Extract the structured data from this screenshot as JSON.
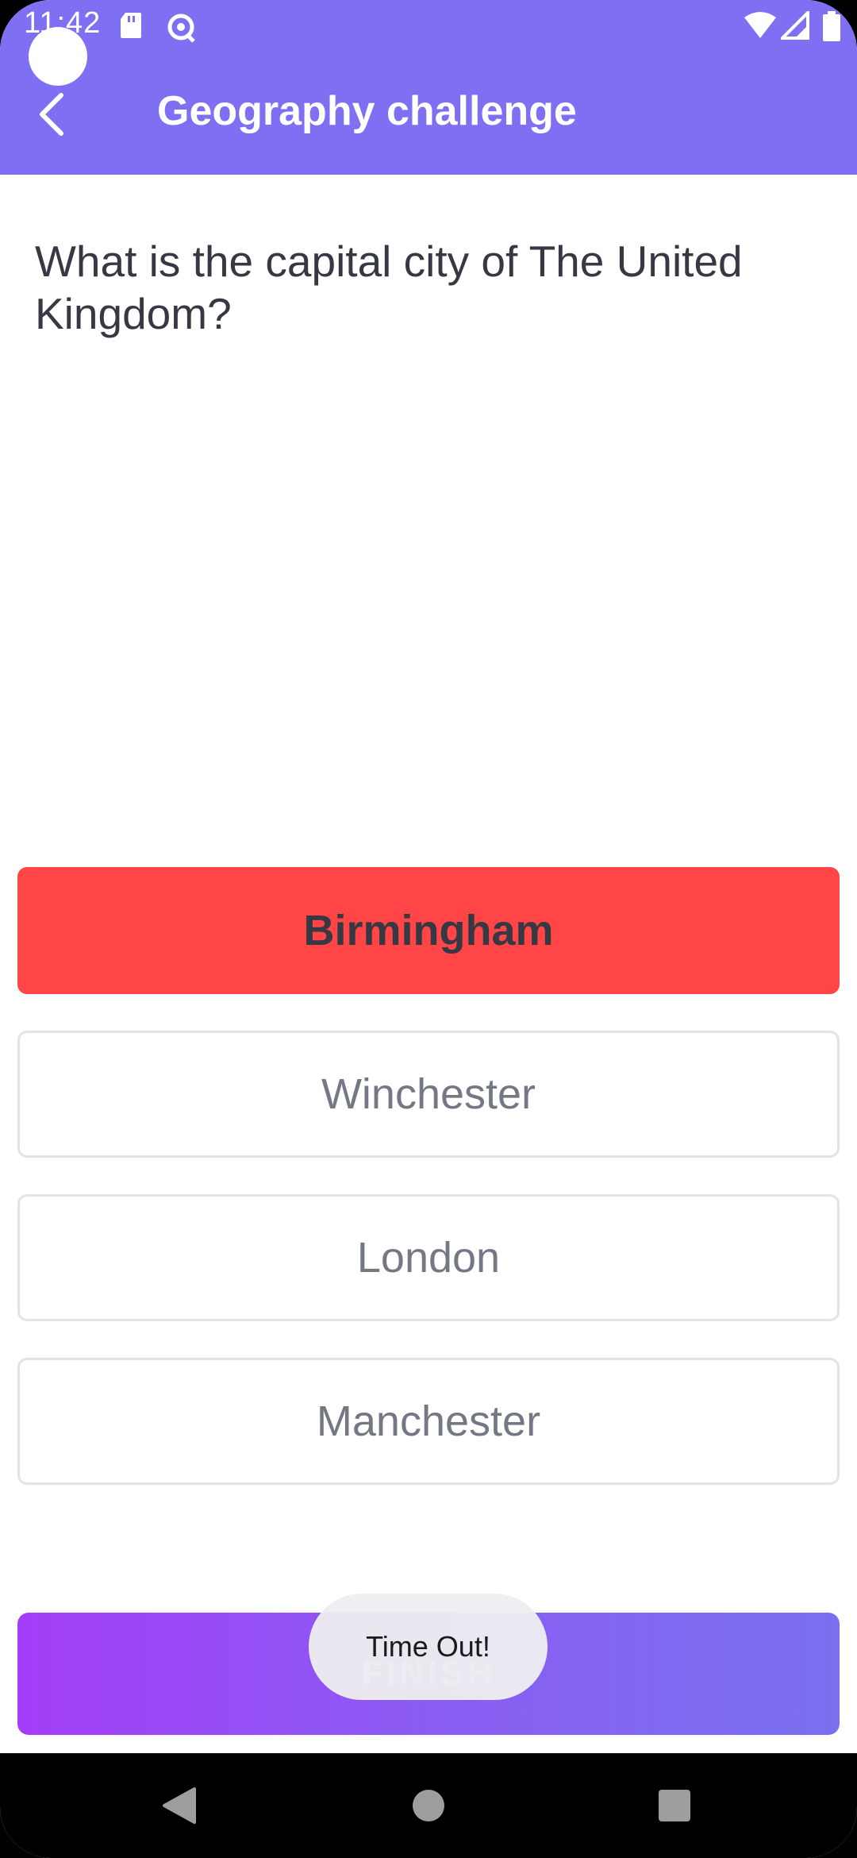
{
  "status_bar": {
    "time": "11:42",
    "icons": [
      "sd-card-icon",
      "sync-icon",
      "wifi-icon",
      "signal-icon",
      "battery-icon"
    ]
  },
  "header": {
    "title": "Geography challenge",
    "background_color": "#7f6ff2"
  },
  "quiz": {
    "question": "What is the capital city of The United Kingdom?",
    "answers": [
      {
        "label": "Birmingham",
        "state": "wrong",
        "color": "#ff4545"
      },
      {
        "label": "Winchester",
        "state": "neutral"
      },
      {
        "label": "London",
        "state": "neutral"
      },
      {
        "label": "Manchester",
        "state": "neutral"
      }
    ]
  },
  "finish_button": {
    "label": "FINISH",
    "gradient": [
      "#a43ef8",
      "#7a71ef"
    ]
  },
  "toast": {
    "message": "Time Out!"
  },
  "nav_bar": {
    "buttons": [
      "back-triangle-icon",
      "home-circle-icon",
      "recents-square-icon"
    ]
  }
}
